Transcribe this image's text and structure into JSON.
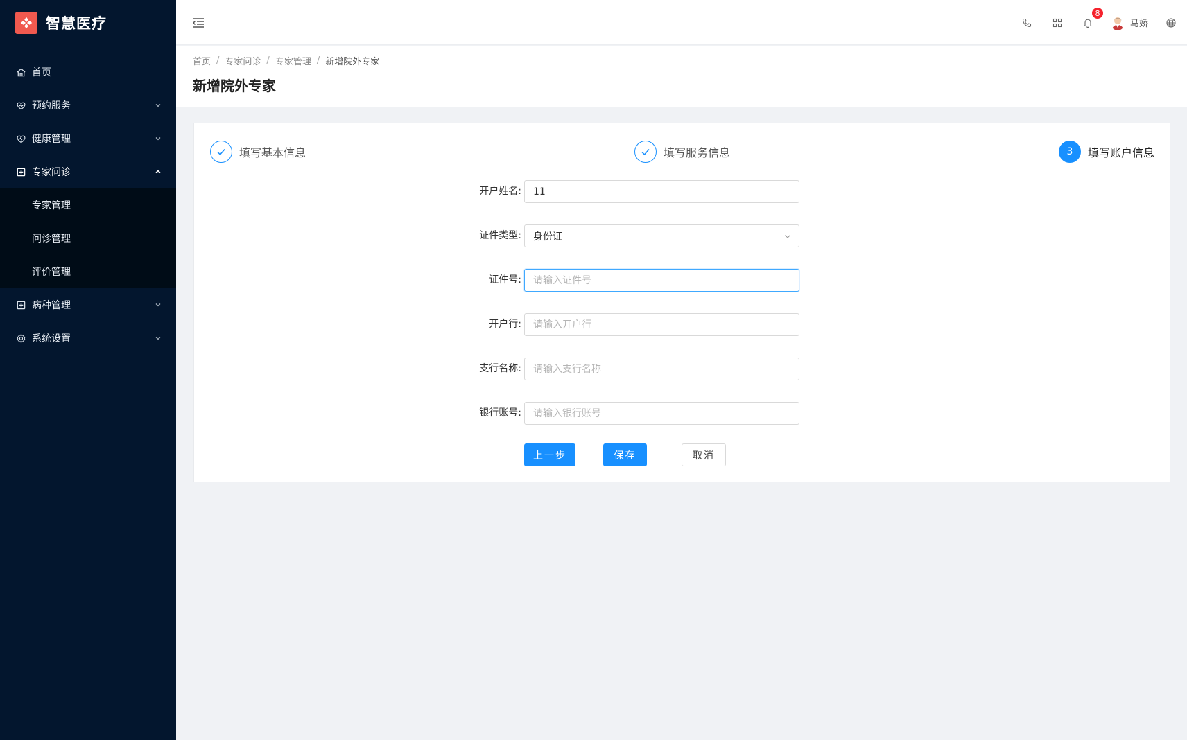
{
  "app": {
    "name": "智慧医疗"
  },
  "sidebar": {
    "items": [
      {
        "label": "首页",
        "icon": "home-icon"
      },
      {
        "label": "预约服务",
        "icon": "heart-icon"
      },
      {
        "label": "健康管理",
        "icon": "heart-pulse-icon"
      },
      {
        "label": "专家问诊",
        "icon": "medical-kit-icon",
        "expanded": true,
        "children": [
          {
            "label": "专家管理"
          },
          {
            "label": "问诊管理"
          },
          {
            "label": "评价管理"
          }
        ]
      },
      {
        "label": "病种管理",
        "icon": "medical-kit-icon"
      },
      {
        "label": "系统设置",
        "icon": "settings-icon"
      }
    ]
  },
  "header": {
    "notifications": {
      "count": "8"
    },
    "user": {
      "name": "马娇"
    },
    "icons": [
      "menu-fold-icon",
      "phone-icon",
      "apps-grid-icon",
      "bell-icon",
      "globe-icon"
    ]
  },
  "breadcrumb": [
    "首页",
    "专家问诊",
    "专家管理",
    "新增院外专家"
  ],
  "page_title": "新增院外专家",
  "steps": [
    {
      "label": "填写基本信息",
      "status": "done"
    },
    {
      "label": "填写服务信息",
      "status": "done"
    },
    {
      "label": "填写账户信息",
      "status": "current",
      "number": "3"
    }
  ],
  "form": {
    "account_name": {
      "label": "开户姓名:",
      "value": "11"
    },
    "id_type": {
      "label": "证件类型:",
      "value": "身份证"
    },
    "id_number": {
      "label": "证件号:",
      "placeholder": "请输入证件号"
    },
    "bank": {
      "label": "开户行:",
      "placeholder": "请输入开户行"
    },
    "branch": {
      "label": "支行名称:",
      "placeholder": "请输入支行名称"
    },
    "bank_account": {
      "label": "银行账号:",
      "placeholder": "请输入银行账号"
    }
  },
  "buttons": {
    "prev": "上一步",
    "save": "保存",
    "cancel": "取消"
  },
  "colors": {
    "sidebar_bg": "#03162e",
    "submenu_bg": "#000c17",
    "primary": "#1890ff",
    "badge": "#f5222d",
    "logo": "#f0594f"
  }
}
